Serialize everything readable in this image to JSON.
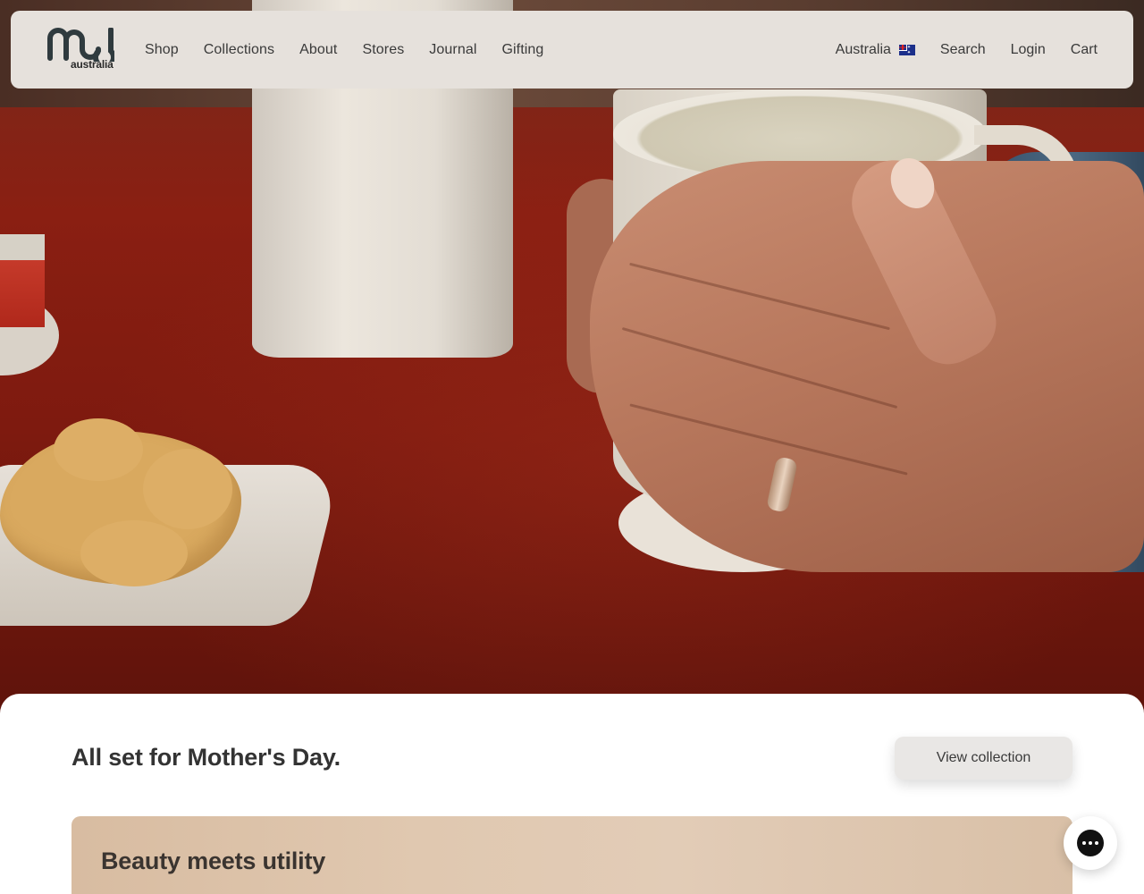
{
  "brand": {
    "logo_text": "mud",
    "logo_subtext": "australia"
  },
  "nav": {
    "items": [
      {
        "label": "Shop"
      },
      {
        "label": "Collections"
      },
      {
        "label": "About"
      },
      {
        "label": "Stores"
      },
      {
        "label": "Journal"
      },
      {
        "label": "Gifting"
      }
    ],
    "country": "Australia",
    "country_flag_icon": "australia-flag-icon",
    "search_label": "Search",
    "login_label": "Login",
    "cart_label": "Cart"
  },
  "hero": {
    "image_subject": "hands holding ceramic mug on red table"
  },
  "promo": {
    "headline": "All set for Mother's Day.",
    "button_label": "View collection"
  },
  "feature_card": {
    "title": "Beauty meets utility"
  },
  "chat": {
    "icon": "chat-bubble-icon"
  },
  "colors": {
    "header_bg": "#e6e1dc",
    "text": "#3a3a3a",
    "table_red": "#8a1f12",
    "card_tan": "#dcc3aa"
  }
}
